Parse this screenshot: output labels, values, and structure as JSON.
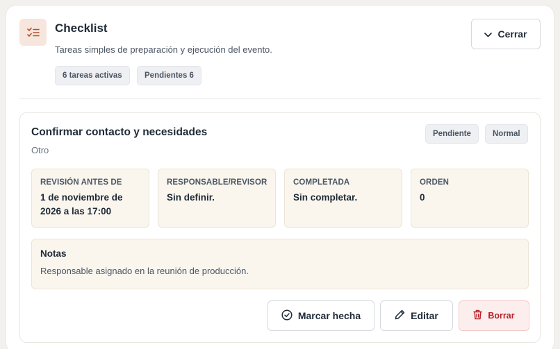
{
  "header": {
    "icon": "checklist-icon",
    "title": "Checklist",
    "subtitle": "Tareas simples de preparación y ejecución del evento.",
    "chips": [
      "6 tareas activas",
      "Pendientes 6"
    ],
    "close_label": "Cerrar"
  },
  "task": {
    "title": "Confirmar contacto y necesidades",
    "category": "Otro",
    "badges": [
      "Pendiente",
      "Normal"
    ],
    "fields": [
      {
        "label": "Revisión antes de",
        "value": "1 de noviembre de 2026 a las 17:00"
      },
      {
        "label": "Responsable/revisor",
        "value": "Sin definir."
      },
      {
        "label": "Completada",
        "value": "Sin completar."
      },
      {
        "label": "Orden",
        "value": "0"
      }
    ],
    "notes_label": "Notas",
    "notes_text": "Responsable asignado en la reunión de producción.",
    "actions": {
      "mark_done": "Marcar hecha",
      "edit": "Editar",
      "delete": "Borrar"
    }
  },
  "colors": {
    "accent_icon_bg": "#f6e6dd",
    "accent_icon": "#b4502a",
    "tile_bg": "#faf6ee",
    "danger": "#b4232a",
    "danger_bg": "#fdeeee"
  }
}
